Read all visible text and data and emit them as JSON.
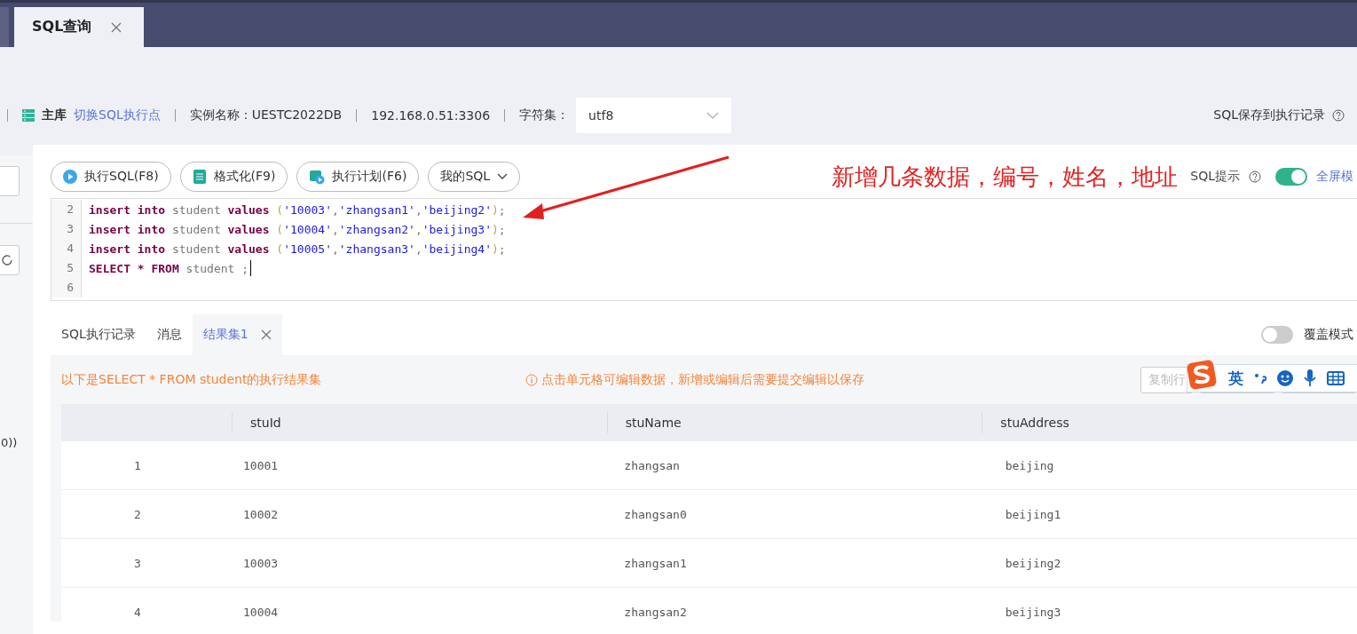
{
  "tabs": [
    {
      "label": "SQL查询",
      "selected": true
    }
  ],
  "info_bar": {
    "db_role": "主库",
    "switch_link": "切换SQL执行点",
    "instance_label": "实例名称：",
    "instance": "UESTC2022DB",
    "address": "192.168.0.51:3306",
    "charset_label": "字符集：",
    "charset": "utf8",
    "save_label": "SQL保存到执行记录"
  },
  "sidebar": {
    "fragment": "0))"
  },
  "toolbar": {
    "buttons": [
      {
        "label": "执行SQL(F8)",
        "kind": "run"
      },
      {
        "label": "格式化(F9)",
        "kind": "format"
      },
      {
        "label": "执行计划(F6)",
        "kind": "plan"
      },
      {
        "label": "我的SQL",
        "kind": "menu"
      }
    ],
    "annotation": "新增几条数据，编号，姓名，地址",
    "sql_hint": {
      "label": "SQL提示",
      "on": true
    },
    "fullscreen": "全屏模"
  },
  "editor": {
    "lines": [
      {
        "number": "2",
        "tokens": [
          {
            "t": "insert into",
            "kind": "keyword"
          },
          {
            "t": " student ",
            "kind": "name"
          },
          {
            "t": "values",
            "kind": "keyword"
          },
          {
            "t": " (",
            "kind": "paren"
          },
          {
            "t": "'10003'",
            "kind": "string"
          },
          {
            "t": ",",
            "kind": "name"
          },
          {
            "t": "'zhangsan1'",
            "kind": "string"
          },
          {
            "t": ",",
            "kind": "name"
          },
          {
            "t": "'beijing2'",
            "kind": "string"
          },
          {
            "t": ")",
            "kind": "paren"
          },
          {
            "t": ";",
            "kind": "name"
          }
        ]
      },
      {
        "number": "3",
        "tokens": [
          {
            "t": "insert into",
            "kind": "keyword"
          },
          {
            "t": " student ",
            "kind": "name"
          },
          {
            "t": "values",
            "kind": "keyword"
          },
          {
            "t": " (",
            "kind": "paren"
          },
          {
            "t": "'10004'",
            "kind": "string"
          },
          {
            "t": ",",
            "kind": "name"
          },
          {
            "t": "'zhangsan2'",
            "kind": "string"
          },
          {
            "t": ",",
            "kind": "name"
          },
          {
            "t": "'beijing3'",
            "kind": "string"
          },
          {
            "t": ")",
            "kind": "paren"
          },
          {
            "t": ";",
            "kind": "name"
          }
        ]
      },
      {
        "number": "4",
        "tokens": [
          {
            "t": "insert into",
            "kind": "keyword"
          },
          {
            "t": " student ",
            "kind": "name"
          },
          {
            "t": "values",
            "kind": "keyword"
          },
          {
            "t": " (",
            "kind": "paren"
          },
          {
            "t": "'10005'",
            "kind": "string"
          },
          {
            "t": ",",
            "kind": "name"
          },
          {
            "t": "'zhangsan3'",
            "kind": "string"
          },
          {
            "t": ",",
            "kind": "name"
          },
          {
            "t": "'beijing4'",
            "kind": "string"
          },
          {
            "t": ")",
            "kind": "paren"
          },
          {
            "t": ";",
            "kind": "name"
          }
        ]
      },
      {
        "number": "5",
        "tokens": [
          {
            "t": "SELECT * FROM",
            "kind": "keyword"
          },
          {
            "t": " student ;",
            "kind": "name"
          }
        ],
        "cursor": true
      },
      {
        "number": "6"
      }
    ]
  },
  "result_tabs": [
    {
      "label": "SQL执行记录",
      "selected": false
    },
    {
      "label": "消息",
      "selected": false
    },
    {
      "label": "结果集1",
      "selected": true,
      "closable": true
    }
  ],
  "overwrite_mode": {
    "label": "覆盖模式",
    "on": false
  },
  "result": {
    "summary": "以下是SELECT * FROM student的执行结果集",
    "notice": "点击单元格可编辑数据，新增或编辑后需要提交编辑以保存",
    "copy_row": "复制行",
    "columns": [
      "",
      "stuId",
      "stuName",
      "stuAddress"
    ],
    "rows": [
      [
        "1",
        "10001",
        "zhangsan",
        "beijing"
      ],
      [
        "2",
        "10002",
        "zhangsan0",
        "beijing1"
      ],
      [
        "3",
        "10003",
        "zhangsan1",
        "beijing2"
      ],
      [
        "4",
        "10004",
        "zhangsan2",
        "beijing3"
      ]
    ]
  },
  "ime_bar": {
    "mode": "英"
  }
}
